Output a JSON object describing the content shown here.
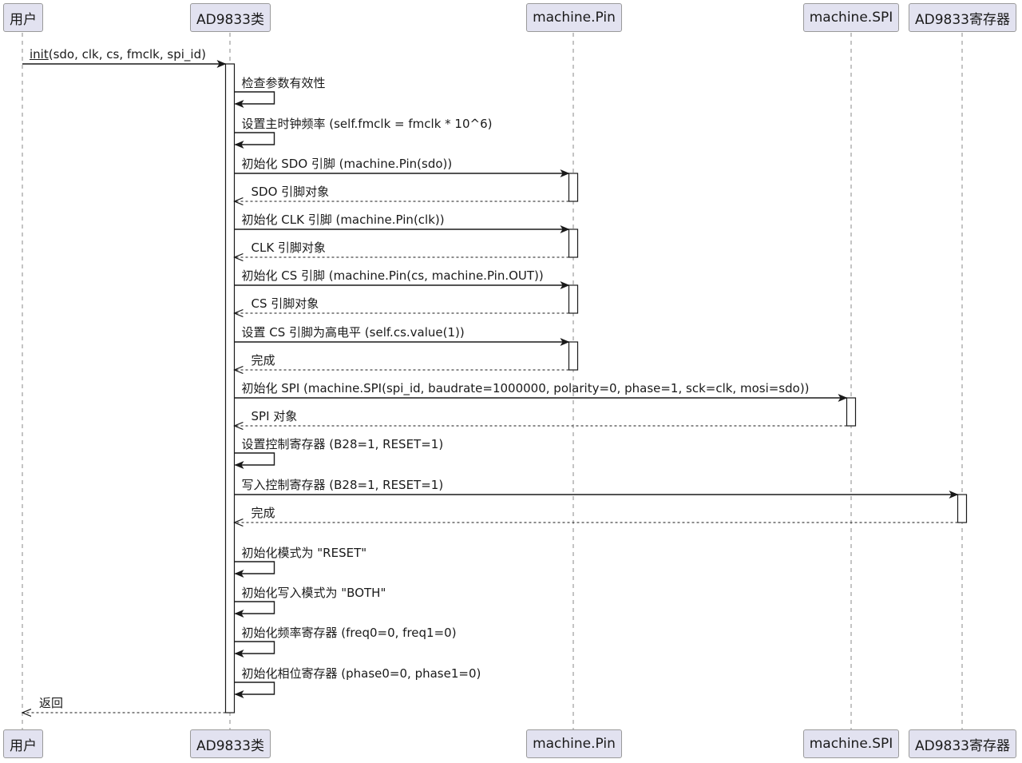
{
  "participants": [
    {
      "id": "user",
      "label": "用户"
    },
    {
      "id": "ad",
      "label": "AD9833类"
    },
    {
      "id": "pin",
      "label": "machine.Pin"
    },
    {
      "id": "spi",
      "label": "machine.SPI"
    },
    {
      "id": "reg",
      "label": "AD9833寄存器"
    }
  ],
  "messages": [
    {
      "from": "user",
      "to": "ad",
      "kind": "call",
      "label_underlined": "init",
      "label": "(sdo, clk, cs, fmclk, spi_id)"
    },
    {
      "from": "ad",
      "to": "ad",
      "kind": "self",
      "label": "检查参数有效性"
    },
    {
      "from": "ad",
      "to": "ad",
      "kind": "self",
      "label": "设置主时钟频率 (self.fmclk = fmclk * 10^6)"
    },
    {
      "from": "ad",
      "to": "pin",
      "kind": "call",
      "label": "初始化 SDO 引脚 (machine.Pin(sdo))"
    },
    {
      "from": "pin",
      "to": "ad",
      "kind": "return",
      "label": "SDO 引脚对象"
    },
    {
      "from": "ad",
      "to": "pin",
      "kind": "call",
      "label": "初始化 CLK 引脚 (machine.Pin(clk))"
    },
    {
      "from": "pin",
      "to": "ad",
      "kind": "return",
      "label": "CLK 引脚对象"
    },
    {
      "from": "ad",
      "to": "pin",
      "kind": "call",
      "label": "初始化 CS 引脚 (machine.Pin(cs, machine.Pin.OUT))"
    },
    {
      "from": "pin",
      "to": "ad",
      "kind": "return",
      "label": "CS 引脚对象"
    },
    {
      "from": "ad",
      "to": "pin",
      "kind": "call",
      "label": "设置 CS 引脚为高电平 (self.cs.value(1))"
    },
    {
      "from": "pin",
      "to": "ad",
      "kind": "return",
      "label": "完成"
    },
    {
      "from": "ad",
      "to": "spi",
      "kind": "call",
      "label": "初始化 SPI (machine.SPI(spi_id, baudrate=1000000, polarity=0, phase=1, sck=clk, mosi=sdo))"
    },
    {
      "from": "spi",
      "to": "ad",
      "kind": "return",
      "label": "SPI 对象"
    },
    {
      "from": "ad",
      "to": "ad",
      "kind": "self",
      "label": "设置控制寄存器 (B28=1, RESET=1)"
    },
    {
      "from": "ad",
      "to": "reg",
      "kind": "call",
      "label": "写入控制寄存器 (B28=1, RESET=1)"
    },
    {
      "from": "reg",
      "to": "ad",
      "kind": "return",
      "label": "完成"
    },
    {
      "from": "ad",
      "to": "ad",
      "kind": "self",
      "label": "初始化模式为 \"RESET\""
    },
    {
      "from": "ad",
      "to": "ad",
      "kind": "self",
      "label": "初始化写入模式为 \"BOTH\""
    },
    {
      "from": "ad",
      "to": "ad",
      "kind": "self",
      "label": "初始化频率寄存器 (freq0=0, freq1=0)"
    },
    {
      "from": "ad",
      "to": "ad",
      "kind": "self",
      "label": "初始化相位寄存器 (phase0=0, phase1=0)"
    },
    {
      "from": "ad",
      "to": "user",
      "kind": "return",
      "label": "返回"
    }
  ]
}
